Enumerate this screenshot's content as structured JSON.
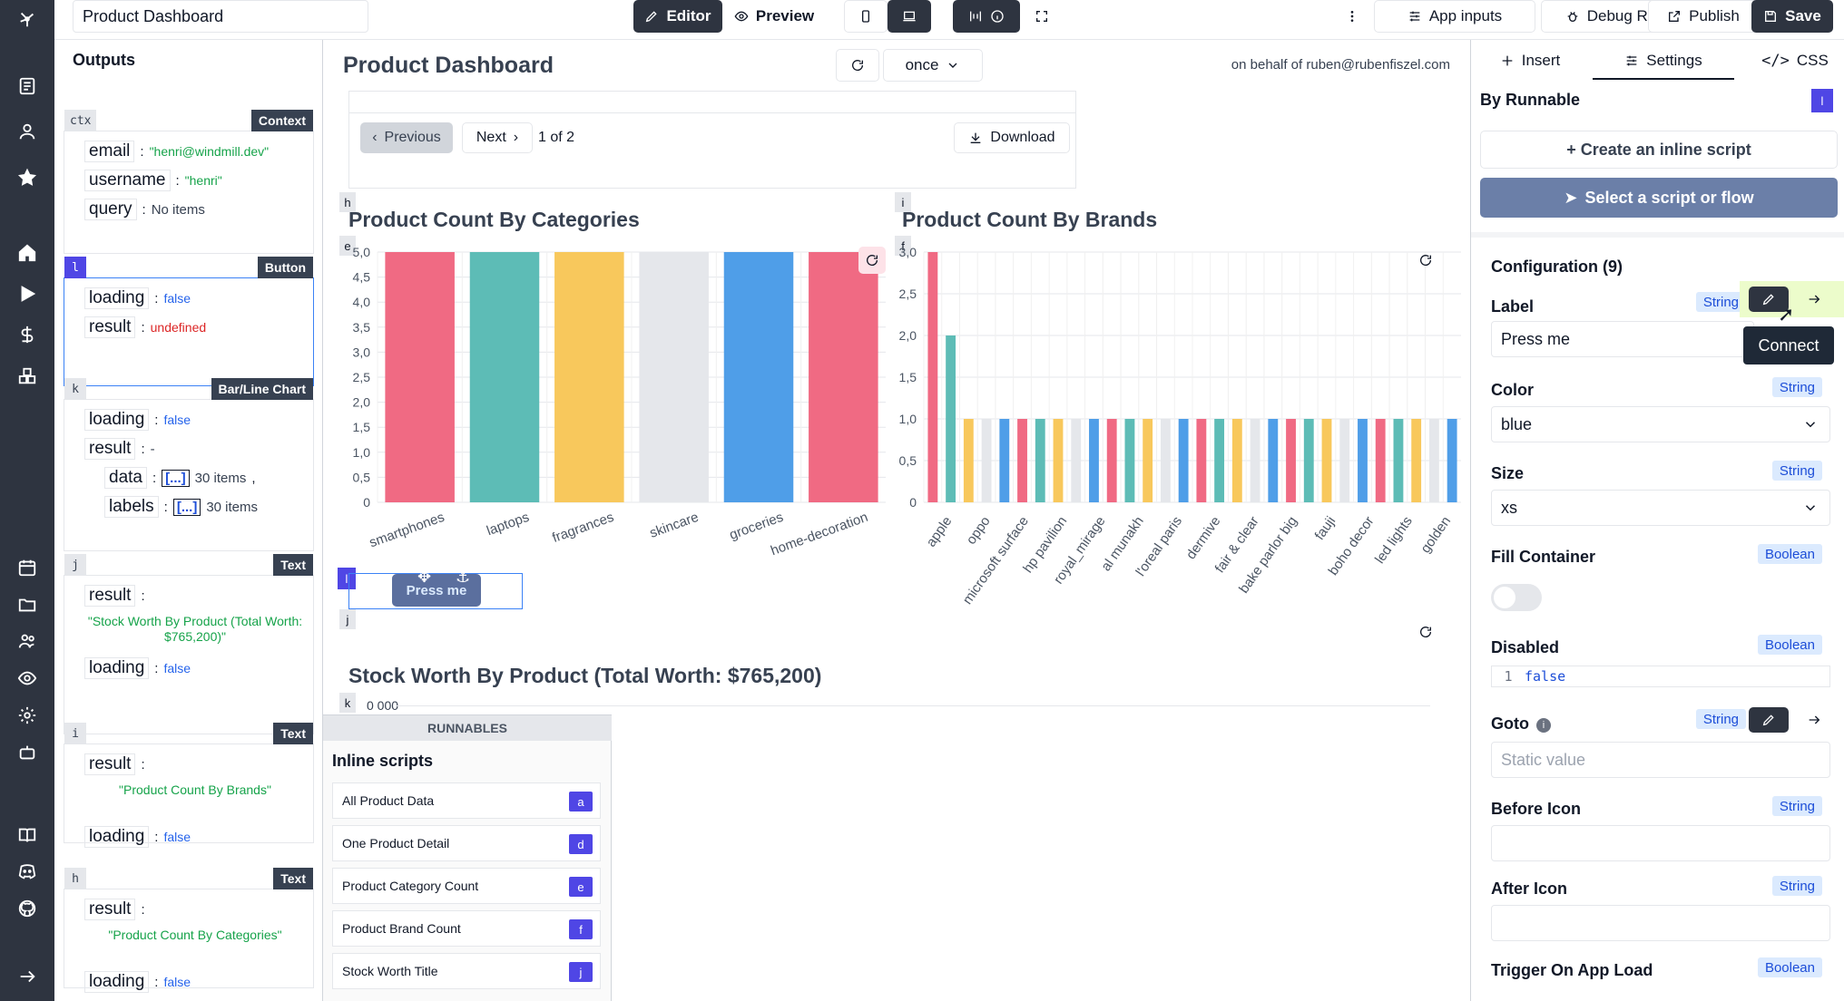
{
  "topbar": {
    "title_value": "Product Dashboard",
    "editor_label": "Editor",
    "preview_label": "Preview",
    "app_inputs_label": "App inputs",
    "debug_runs_label": "Debug Runs",
    "publish_label": "Publish",
    "save_label": "Save"
  },
  "outputs": {
    "title": "Outputs",
    "cards": [
      {
        "tag": "ctx",
        "type": "Context",
        "rows": [
          {
            "key": "email",
            "value": "\"henri@windmill.dev\"",
            "kind": "str"
          },
          {
            "key": "username",
            "value": "\"henri\"",
            "kind": "str"
          },
          {
            "key": "query",
            "value": "No items",
            "kind": "plain"
          }
        ]
      },
      {
        "tag": "l",
        "type": "Button",
        "rows": [
          {
            "key": "loading",
            "value": "false",
            "kind": "bool"
          },
          {
            "key": "result",
            "value": "undefined",
            "kind": "undef"
          }
        ]
      },
      {
        "tag": "k",
        "type": "Bar/Line Chart",
        "rows": [
          {
            "key": "loading",
            "value": "false",
            "kind": "bool"
          },
          {
            "key": "result",
            "value": "-",
            "kind": "plain"
          },
          {
            "key": "data",
            "value": "30 items",
            "kind": "plain",
            "bracket": "[...]",
            "suffix": ","
          },
          {
            "key": "labels",
            "value": "30 items",
            "kind": "plain",
            "bracket": "[...]"
          }
        ]
      },
      {
        "tag": "j",
        "type": "Text",
        "rows": [
          {
            "key": "result",
            "value": "",
            "kind": "plain"
          },
          {
            "key": "",
            "value": "\"Stock Worth By Product (Total Worth: $765,200)\"",
            "kind": "str"
          },
          {
            "key": "loading",
            "value": "false",
            "kind": "bool"
          }
        ]
      },
      {
        "tag": "i",
        "type": "Text",
        "rows": [
          {
            "key": "result",
            "value": "",
            "kind": "plain"
          },
          {
            "key": "",
            "value": "\"Product Count By Brands\"",
            "kind": "str"
          },
          {
            "key": "loading",
            "value": "false",
            "kind": "bool"
          }
        ]
      },
      {
        "tag": "h",
        "type": "Text",
        "rows": [
          {
            "key": "result",
            "value": "",
            "kind": "plain"
          },
          {
            "key": "",
            "value": "\"Product Count By Categories\"",
            "kind": "str"
          },
          {
            "key": "loading",
            "value": "false",
            "kind": "bool"
          }
        ]
      }
    ]
  },
  "canvas": {
    "app_title": "Product Dashboard",
    "refresh_mode": "once",
    "on_behalf": "on behalf of ruben@rubenfiszel.com",
    "table_prev": "Previous",
    "table_next": "Next",
    "table_page": "1 of 2",
    "table_download": "Download",
    "components": {
      "h": "h",
      "i": "i",
      "e": "e",
      "f": "f",
      "l": "l",
      "j": "j",
      "k": "k"
    },
    "title_categories": "Product Count By Categories",
    "title_brands": "Product Count By Brands",
    "button_label": "Press me",
    "title_stock": "Stock Worth By Product (Total Worth: $765,200)",
    "stock_axis_partial": "0 000"
  },
  "chart_data": [
    {
      "type": "bar",
      "title": "Product Count By Categories",
      "categories": [
        "smartphones",
        "laptops",
        "fragrances",
        "skincare",
        "groceries",
        "home-decoration"
      ],
      "values": [
        5,
        5,
        5,
        5,
        5,
        5
      ],
      "ylim": [
        0,
        5
      ],
      "yticks": [
        "0",
        "0,5",
        "1,0",
        "1,5",
        "2,0",
        "2,5",
        "3,0",
        "3,5",
        "4,0",
        "4,5",
        "5,0"
      ],
      "colors": [
        "#f06a83",
        "#5dbcb6",
        "#f8c85c",
        "#e5e7eb",
        "#4f9ee8",
        "#f06a83"
      ]
    },
    {
      "type": "bar",
      "title": "Product Count By Brands",
      "categories": [
        "apple",
        "oppo",
        "microsoft surface",
        "hp pavilion",
        "royal_mirage",
        "al munakh",
        "l'oreal paris",
        "dermive",
        "fair & clear",
        "bake parlor big",
        "fauji",
        "boho decor",
        "led lights",
        "golden"
      ],
      "values": [
        3,
        2,
        1,
        1,
        1,
        1,
        1,
        1,
        1,
        1,
        1,
        1,
        1,
        1,
        1,
        1,
        1,
        1,
        1,
        1,
        1,
        1,
        1,
        1,
        1,
        1,
        1,
        1,
        1,
        1
      ],
      "ylim": [
        0,
        3
      ],
      "yticks": [
        "0",
        "0,5",
        "1,0",
        "1,5",
        "2,0",
        "2,5",
        "3,0"
      ],
      "colors": [
        "#f06a83",
        "#5dbcb6",
        "#f8c85c",
        "#e5e7eb",
        "#4f9ee8"
      ]
    }
  ],
  "runnables": {
    "header": "RUNNABLES",
    "section": "Inline scripts",
    "items": [
      {
        "name": "All Product Data",
        "tag": "a"
      },
      {
        "name": "One Product Detail",
        "tag": "d"
      },
      {
        "name": "Product Category Count",
        "tag": "e"
      },
      {
        "name": "Product Brand Count",
        "tag": "f"
      },
      {
        "name": "Stock Worth Title",
        "tag": "j"
      }
    ]
  },
  "rpanel": {
    "tab_insert": "Insert",
    "tab_settings": "Settings",
    "tab_css": "CSS",
    "by_runnable": "By Runnable",
    "by_runnable_tag": "l",
    "create_inline": "+ Create an inline script",
    "select_script": "Select a script or flow",
    "config_title": "Configuration (9)",
    "tooltip": "Connect",
    "fields": {
      "label": {
        "name": "Label",
        "type": "String",
        "value": "Press me"
      },
      "color": {
        "name": "Color",
        "type": "String",
        "value": "blue"
      },
      "size": {
        "name": "Size",
        "type": "String",
        "value": "xs"
      },
      "fill": {
        "name": "Fill Container",
        "type": "Boolean"
      },
      "disabled": {
        "name": "Disabled",
        "type": "Boolean",
        "line": "1",
        "value": "false"
      },
      "goto": {
        "name": "Goto",
        "type": "String",
        "placeholder": "Static value"
      },
      "before": {
        "name": "Before Icon",
        "type": "String"
      },
      "after": {
        "name": "After Icon",
        "type": "String"
      },
      "trigger": {
        "name": "Trigger On App Load",
        "type": "Boolean"
      }
    }
  }
}
